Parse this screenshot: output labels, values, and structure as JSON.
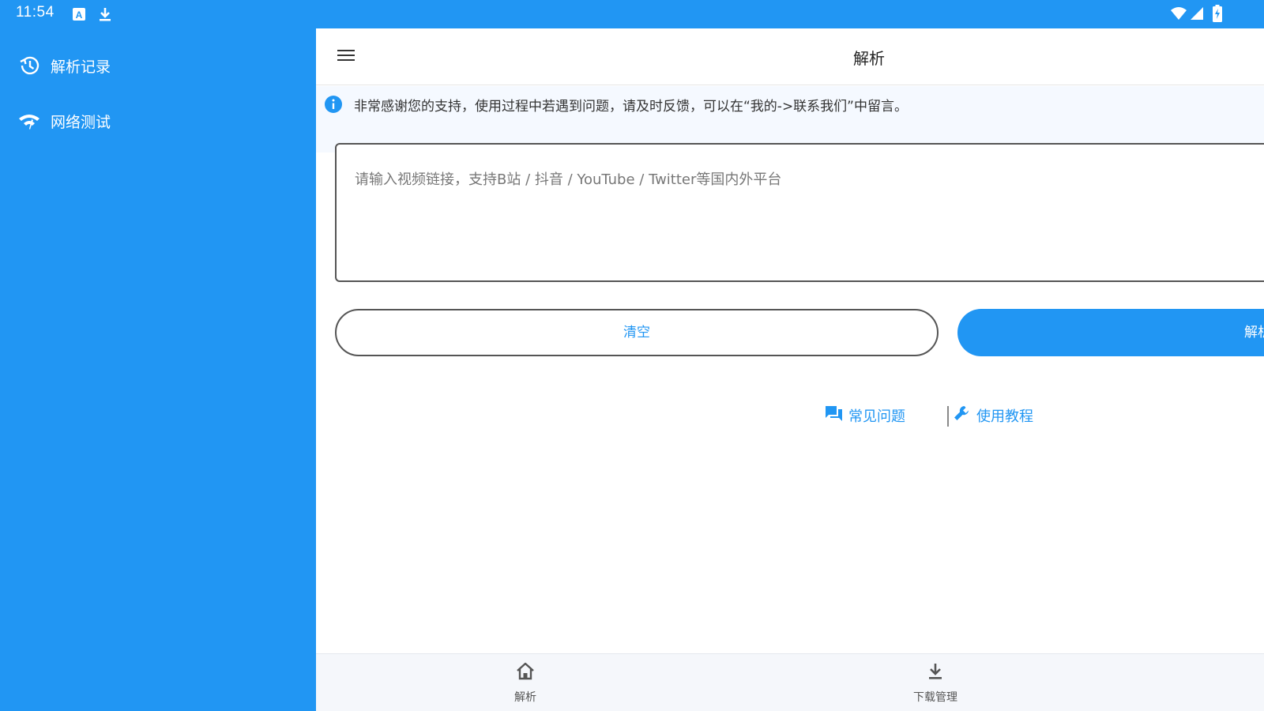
{
  "status_bar": {
    "time": "11:54",
    "left_icons": [
      "keyboard-a-icon",
      "download-icon"
    ],
    "right_icons": [
      "wifi-icon",
      "signal-icon",
      "battery-charging-icon"
    ]
  },
  "drawer": {
    "items": [
      {
        "icon": "history-icon",
        "label": "解析记录"
      },
      {
        "icon": "network-test-icon",
        "label": "网络测试"
      }
    ]
  },
  "appbar": {
    "menu_icon": "hamburger-menu-icon",
    "title": "解析"
  },
  "notice": {
    "icon": "info-icon",
    "text": "非常感谢您的支持，使用过程中若遇到问题，请及时反馈，可以在“我的->联系我们”中留言。"
  },
  "url_input": {
    "value": "",
    "placeholder": "请输入视频链接，支持B站 / 抖音 / YouTube / Twitter等国内外平台"
  },
  "buttons": {
    "clear_label": "清空",
    "parse_label": "解析"
  },
  "links": [
    {
      "icon": "chat-icon",
      "label": "常见问题"
    },
    {
      "icon": "wrench-icon",
      "label": "使用教程"
    }
  ],
  "bottom_nav": [
    {
      "icon": "home-icon",
      "label": "解析"
    },
    {
      "icon": "download-icon",
      "label": "下载管理"
    }
  ],
  "colors": {
    "primary": "#2196f3",
    "notice_bg": "#f5f9ff",
    "bottom_nav_bg": "#f5f7fb",
    "text_dark": "#222222"
  }
}
